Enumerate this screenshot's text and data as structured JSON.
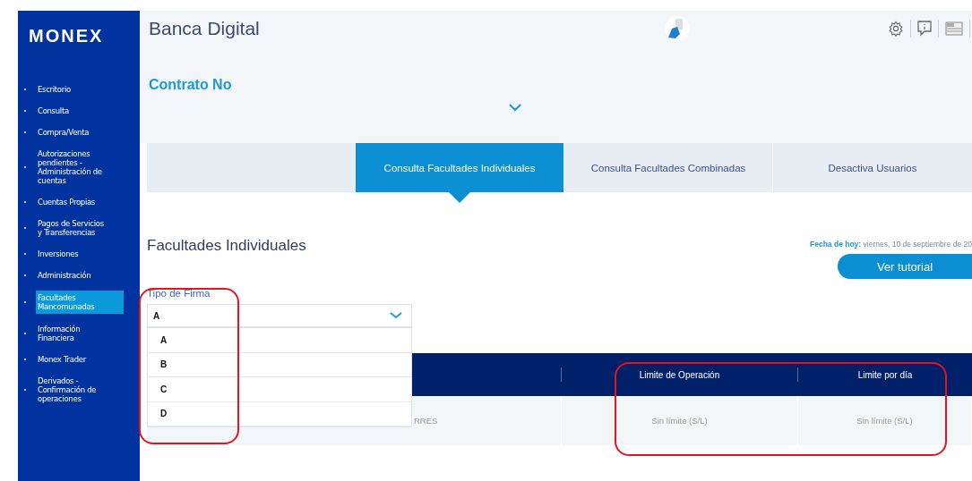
{
  "sidebar": {
    "logo": "MONEX",
    "items": [
      {
        "label": "Escritorio",
        "selected": false
      },
      {
        "label": "Consulta",
        "selected": false
      },
      {
        "label": "Compra/Venta",
        "selected": false
      },
      {
        "label": "Autorizaciones pendientes - Administración de cuentas",
        "selected": false
      },
      {
        "label": "Cuentas Propias",
        "selected": false
      },
      {
        "label": "Pagos de Servicios y Transferencias",
        "selected": false
      },
      {
        "label": "Inversiones",
        "selected": false
      },
      {
        "label": "Administración",
        "selected": false
      },
      {
        "label": "Facultades Mancomunadas",
        "selected": true
      },
      {
        "label": "Información Financiera",
        "selected": false
      },
      {
        "label": "Monex Trader",
        "selected": false
      },
      {
        "label": "Derivados - Confirmación de operaciones",
        "selected": false
      }
    ]
  },
  "header": {
    "title": "Banca Digital",
    "contract_label": "Contrato No"
  },
  "tabs": [
    {
      "label": "Consulta Facultades Individuales",
      "selected": true
    },
    {
      "label": "Consulta Facultades Combinadas",
      "selected": false
    },
    {
      "label": "Desactiva Usuarios",
      "selected": false
    }
  ],
  "section": {
    "title": "Facultades Individuales",
    "date": "**Fecha de hoy:** viernes, 10 de septiembre de 20",
    "tutorial_button": "Ver tutorial"
  },
  "signature_select": {
    "label": "Tipo de Firma",
    "value": "A",
    "expanded": true,
    "options": [
      "A",
      "B",
      "C",
      "D"
    ]
  },
  "table": {
    "columns": [
      "Limite de Operación",
      "Limite por día"
    ],
    "rows": [
      {
        "column_1": "RRES",
        "cells": [
          "Sin límite (S/L)",
          "Sin límite (S/L)"
        ]
      }
    ]
  }
}
